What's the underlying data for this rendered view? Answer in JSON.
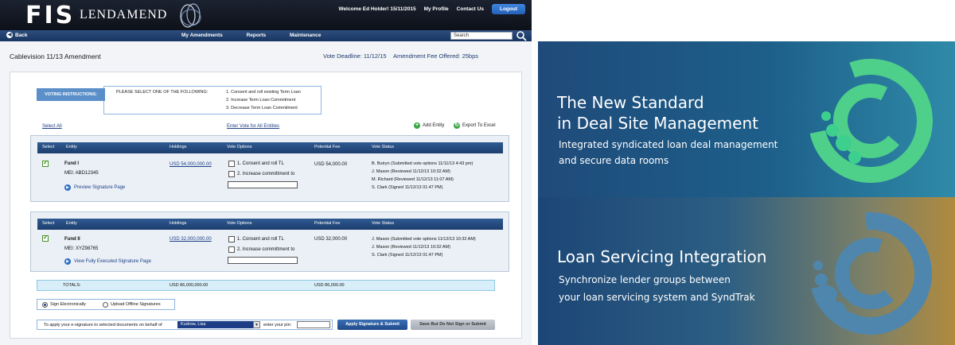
{
  "header": {
    "logo_fis": "FIS",
    "logo_product": "LENDAMEND",
    "welcome": "Welcome  Ed Holder! 15/11/2015",
    "my_profile": "My Profile",
    "contact_us": "Contact Us",
    "logout": "Logout"
  },
  "nav": {
    "back": "Back",
    "items": [
      "My Amendments",
      "Reports",
      "Maintenance"
    ],
    "search_placeholder": "Search"
  },
  "page": {
    "title": "Cablevision 11/13 Amendment",
    "vote_deadline": "Vote Deadline: 11/12/15",
    "fee_offered": "Amendment Fee Offered: 25bps"
  },
  "instructions": {
    "tag": "VOTING INSTRUCTIONS:",
    "lead": "PLEASE SELECT ONE OF THE FOLLOWING:",
    "options": [
      "1. Consent and roll existing Term Loan",
      "2. Increase Term Loan Commitment",
      "3. Decrease Term Loan Commitment"
    ]
  },
  "actions": {
    "select_all": "Select All",
    "enter_vote_all": "Enter Vote for All Entities",
    "add_entity": "Add Entity",
    "export_excel": "Export To Excel"
  },
  "table": {
    "columns": [
      "Select",
      "Entity",
      "Holdings",
      "Vote Options",
      "Potential Fee",
      "Vote Status"
    ],
    "vote_options": [
      "1. Consent and roll TL",
      "2. Increase committment to"
    ],
    "rows": [
      {
        "fund": "Fund I",
        "mei": "MEI: ABD12345",
        "link": "Preview Signature Page",
        "holdings": "USD 54,000,000.00",
        "fee": "USD 54,000.00",
        "status": [
          "B. Butryn (Submitted vote options 11/11/13 4:43 pm)",
          "J. Mason (Reviewed 11/12/13 10:32 AM)",
          "M. Richard (Reviewed 11/12/13 11:07 AM)",
          "S. Clark (Signed 11/12/13 01:47 PM)"
        ]
      },
      {
        "fund": "Fund II",
        "mei": "MEI: XYZ98765",
        "link": "View Fully Executed Signature Page",
        "holdings": "USD 32,000,000.00",
        "fee": "USD 32,000.00",
        "status": [
          "J. Mason (Submitted vote options 11/12/13 10:32 AM)",
          "J. Mason (Reviewed 11/12/13 10:32 AM)",
          "S. Clark (Signed 11/12/13 01:47 PM)"
        ]
      }
    ],
    "totals_label": "TOTALS:",
    "totals_holdings": "USD 86,000,000.00",
    "totals_fee": "USD 86,000.00"
  },
  "signing": {
    "option_electronic": "Sign Electronically",
    "option_offline": "Upload Offline Signatures",
    "apply_label": "To apply your e-signature to selected documents on behalf of",
    "behalf_value": "Kudrow, Lisa",
    "pin_label": "enter your pin:",
    "apply_button": "Apply Signature & Submit",
    "save_button": "Save But Do Not Sign or Submit"
  },
  "promo": {
    "headline1_line1": "The New Standard",
    "headline1_line2": "in Deal Site Management",
    "sub1_line1": "Integrated syndicated loan deal management",
    "sub1_line2": "and secure data rooms",
    "headline2": "Loan Servicing Integration",
    "sub2_line1": "Synchronize lender groups between",
    "sub2_line2": "your loan servicing system and SyndTrak"
  },
  "colors": {
    "nav_blue": "#1d3e6e",
    "accent_green": "#39a645",
    "promo_green": "#4fd08a",
    "promo_gold": "#b08a3e"
  }
}
